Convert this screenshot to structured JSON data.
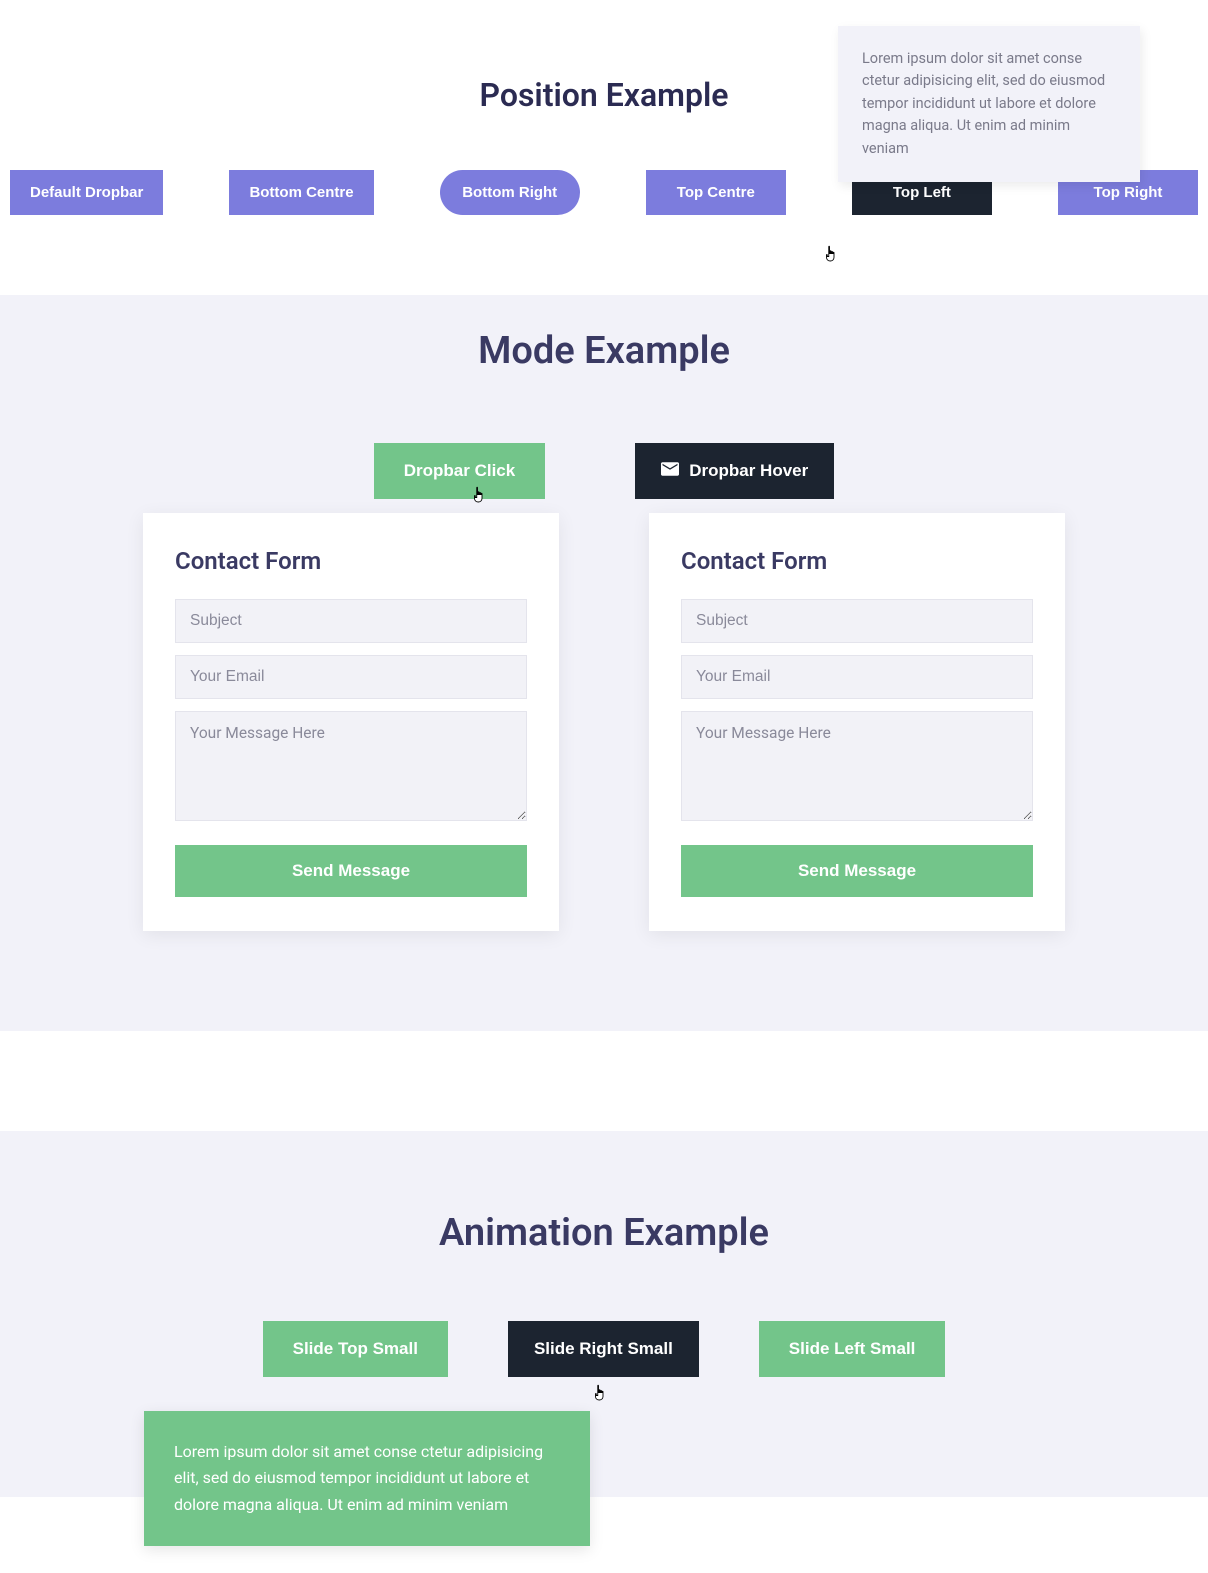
{
  "position": {
    "title": "Position Example",
    "tooltip": "Lorem ipsum dolor sit amet conse ctetur adipisicing elit, sed do eiusmod tempor incididunt ut labore et dolore magna aliqua. Ut enim ad minim veniam",
    "buttons": {
      "default": "Default Dropbar",
      "bottom_center": "Bottom Centre",
      "bottom_right": "Bottom Right",
      "top_center": "Top Centre",
      "top_left": "Top Left",
      "top_right": "Top Right"
    }
  },
  "mode": {
    "title": "Mode Example",
    "click_label": "Dropbar Click",
    "hover_label": "Dropbar Hover",
    "form": {
      "title": "Contact Form",
      "subject_placeholder": "Subject",
      "email_placeholder": "Your Email",
      "message_placeholder": "Your Message Here",
      "submit": "Send Message"
    }
  },
  "animation": {
    "title": "Animation Example",
    "buttons": {
      "slide_top": "Slide Top Small",
      "slide_right": "Slide Right Small",
      "slide_left": "Slide Left Small"
    },
    "dropdown_text": "Lorem ipsum dolor sit amet conse ctetur adipisicing elit, sed do eiusmod tempor incididunt ut labore et dolore magna aliqua. Ut enim ad minim veniam"
  }
}
